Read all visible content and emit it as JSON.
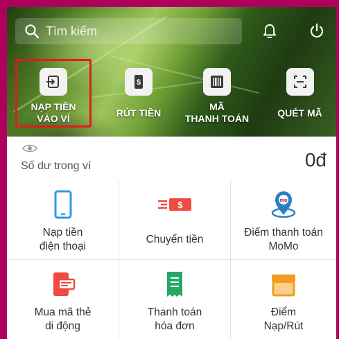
{
  "search": {
    "placeholder": "Tìm kiếm",
    "icon": "search-icon"
  },
  "header_icons": [
    {
      "name": "bell-icon"
    },
    {
      "name": "power-icon"
    }
  ],
  "actions": [
    {
      "label": "NẠP TIỀN\nVÀO VÍ",
      "icon": "deposit-icon",
      "highlighted": true
    },
    {
      "label": "RÚT TIỀN",
      "icon": "withdraw-icon"
    },
    {
      "label": "MÃ\nTHANH TOÁN",
      "icon": "barcode-icon"
    },
    {
      "label": "QUÉT MÃ",
      "icon": "scan-icon"
    }
  ],
  "balance": {
    "label": "Số dư trong ví",
    "value": "0đ",
    "icon": "eye-icon"
  },
  "services": [
    {
      "label": "Nạp tiền\nđiện thoại",
      "icon": "phone-icon",
      "color": "#2a9be6"
    },
    {
      "label": "Chuyển tiền",
      "icon": "money-transfer-icon",
      "color": "#ef4a43"
    },
    {
      "label": "Điểm thanh toán\nMoMo",
      "icon": "momo-location-icon",
      "color": "#2c7fc3"
    },
    {
      "label": "Mua mã thẻ\ndi động",
      "icon": "mobile-card-icon",
      "color": "#ef4a43"
    },
    {
      "label": "Thanh toán\nhóa đơn",
      "icon": "bill-icon",
      "color": "#27a86a"
    },
    {
      "label": "Điểm\nNạp/Rút",
      "icon": "store-icon",
      "color": "#f39c1f"
    }
  ],
  "colors": {
    "highlight": "#e3191d",
    "frame": "#b0005e"
  }
}
